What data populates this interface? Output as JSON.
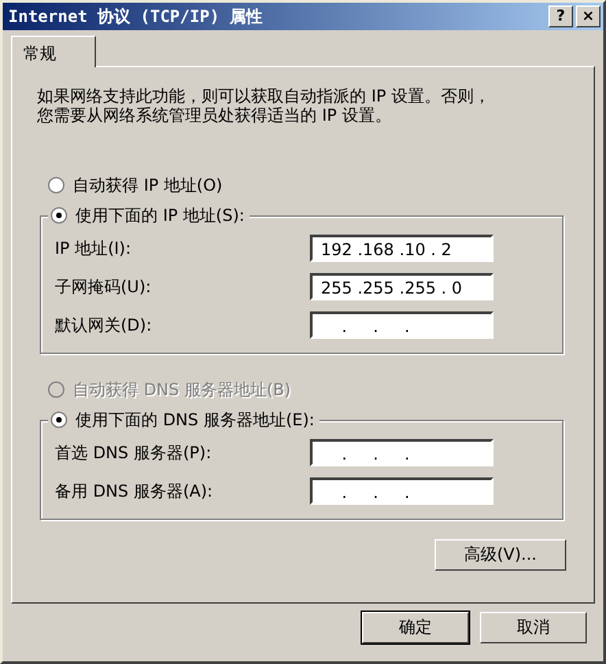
{
  "window": {
    "title": "Internet 协议 (TCP/IP) 属性",
    "title_buttons": [
      "?",
      "×"
    ]
  },
  "tabs": [
    {
      "label": "常规",
      "selected": true
    }
  ],
  "intro_lines": [
    "如果网络支持此功能，则可以获取自动指派的 IP 设置。否则，",
    "您需要从网络系统管理员处获得适当的 IP 设置。"
  ],
  "ip": {
    "auto_option": {
      "label": "自动获得 IP 地址(O)",
      "selected": false,
      "disabled": false
    },
    "manual_option": {
      "label": "使用下面的 IP 地址(S):",
      "selected": true,
      "disabled": false
    },
    "fields": [
      {
        "label": "IP 地址(I):",
        "value": "192 .168 .10 . 2"
      },
      {
        "label": "子网掩码(U):",
        "value": "255 .255 .255 . 0"
      },
      {
        "label": "默认网关(D):",
        "value": "    .     .     ."
      }
    ]
  },
  "dns": {
    "auto_option": {
      "label": "自动获得 DNS 服务器地址(B)",
      "selected": false,
      "disabled": true
    },
    "manual_option": {
      "label": "使用下面的 DNS 服务器地址(E):",
      "selected": true,
      "disabled": false
    },
    "fields": [
      {
        "label": "首选 DNS 服务器(P):",
        "value": "    .     .     ."
      },
      {
        "label": "备用 DNS 服务器(A):",
        "value": "    .     .     ."
      }
    ]
  },
  "advanced_button": "高级(V)...",
  "buttons": [
    "确定",
    "取消"
  ]
}
